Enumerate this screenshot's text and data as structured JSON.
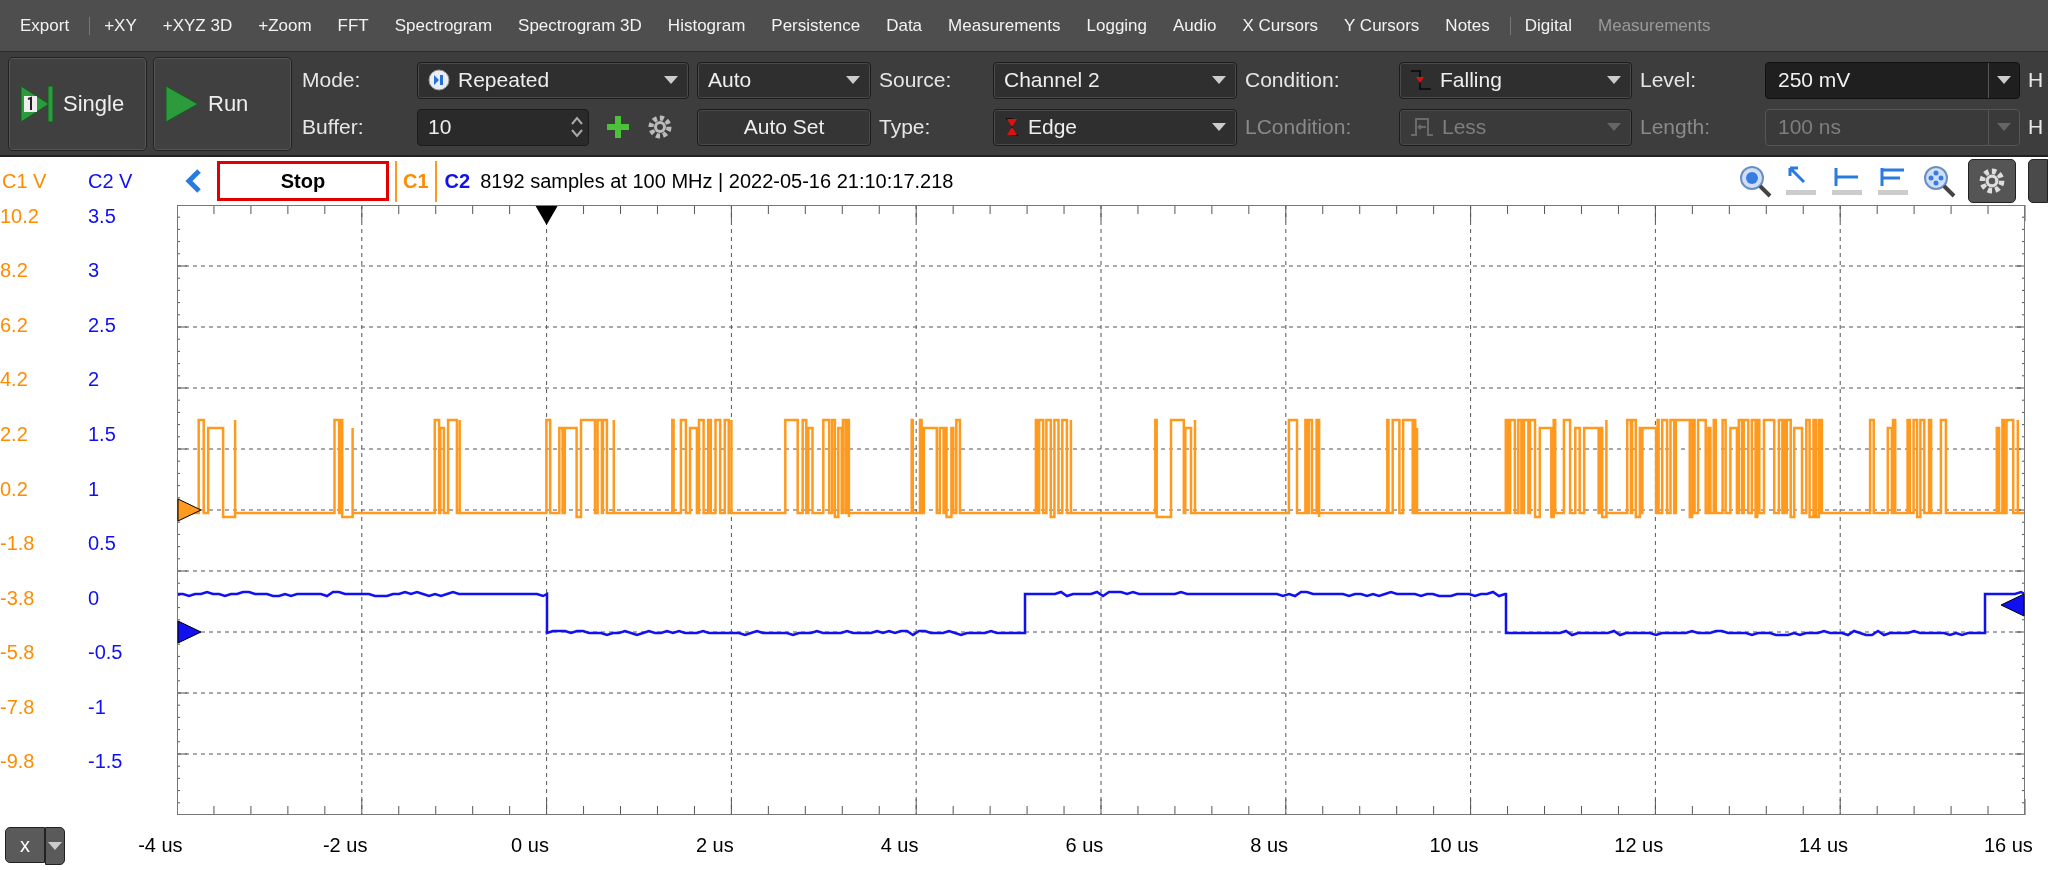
{
  "menu": [
    {
      "label": "Export",
      "disabled": false,
      "separator_after": true
    },
    {
      "label": "+XY",
      "disabled": false,
      "separator_after": false
    },
    {
      "label": "+XYZ 3D",
      "disabled": false,
      "separator_after": false
    },
    {
      "label": "+Zoom",
      "disabled": false,
      "separator_after": false
    },
    {
      "label": "FFT",
      "disabled": false,
      "separator_after": false
    },
    {
      "label": "Spectrogram",
      "disabled": false,
      "separator_after": false
    },
    {
      "label": "Spectrogram 3D",
      "disabled": false,
      "separator_after": false
    },
    {
      "label": "Histogram",
      "disabled": false,
      "separator_after": false
    },
    {
      "label": "Persistence",
      "disabled": false,
      "separator_after": false
    },
    {
      "label": "Data",
      "disabled": false,
      "separator_after": false
    },
    {
      "label": "Measurements",
      "disabled": false,
      "separator_after": false
    },
    {
      "label": "Logging",
      "disabled": false,
      "separator_after": false
    },
    {
      "label": "Audio",
      "disabled": false,
      "separator_after": false
    },
    {
      "label": "X Cursors",
      "disabled": false,
      "separator_after": false
    },
    {
      "label": "Y Cursors",
      "disabled": false,
      "separator_after": false
    },
    {
      "label": "Notes",
      "disabled": false,
      "separator_after": true
    },
    {
      "label": "Digital",
      "disabled": false,
      "separator_after": false
    },
    {
      "label": "Measurements",
      "disabled": true,
      "separator_after": false
    }
  ],
  "toolbar": {
    "single_button": "Single",
    "run_button": "Run",
    "mode": {
      "label": "Mode:",
      "value": "Repeated"
    },
    "auto_mode": {
      "value": "Auto"
    },
    "buffer": {
      "label": "Buffer:",
      "value": "10"
    },
    "auto_set_button": "Auto Set",
    "source": {
      "label": "Source:",
      "value": "Channel 2"
    },
    "type": {
      "label": "Type:",
      "value": "Edge"
    },
    "condition": {
      "label": "Condition:",
      "value": "Falling",
      "disabled": false
    },
    "lcondition": {
      "label": "LCondition:",
      "value": "Less",
      "disabled": true
    },
    "level": {
      "label": "Level:",
      "value": "250 mV",
      "disabled": false
    },
    "length": {
      "label": "Length:",
      "value": "100 ns",
      "disabled": true
    },
    "cut_labels": [
      "H",
      "H"
    ]
  },
  "plot_header": {
    "c1_axis_title": "C1 V",
    "c2_axis_title": "C2 V",
    "stop_button": "Stop",
    "c1_tag": "C1",
    "c2_tag": "C2",
    "info": "8192 samples at 100 MHz | 2022-05-16 21:10:17.218"
  },
  "y_axis_c1": [
    "10.2",
    "8.2",
    "6.2",
    "4.2",
    "2.2",
    "0.2",
    "-1.8",
    "-3.8",
    "-5.8",
    "-7.8",
    "-9.8"
  ],
  "y_axis_c2": [
    "3.5",
    "3",
    "2.5",
    "2",
    "1.5",
    "1",
    "0.5",
    "0",
    "-0.5",
    "-1",
    "-1.5"
  ],
  "x_axis_button": "x",
  "x_axis": [
    "-4 us",
    "-2 us",
    "0 us",
    "2 us",
    "4 us",
    "6 us",
    "8 us",
    "10 us",
    "12 us",
    "14 us",
    "16 us"
  ]
}
